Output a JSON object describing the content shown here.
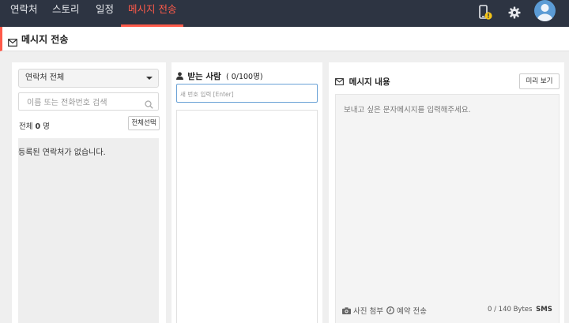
{
  "nav": {
    "items": [
      "연락처",
      "스토리",
      "일정",
      "메시지 전송"
    ],
    "active_index": 3
  },
  "icons": {
    "device": "phone-alert-icon",
    "settings": "gear-icon",
    "profile": "user-avatar-icon"
  },
  "colors": {
    "accent": "#ff5a4a",
    "nav_bg": "#2d3442",
    "alert": "#f5c518",
    "focus": "#6aa2d6"
  },
  "page": {
    "title": "메시지 전송"
  },
  "contacts": {
    "filter": "연락처 전체",
    "search_placeholder": "이름 또는 전화번호 검색",
    "count_prefix": "전체",
    "count_value": "0",
    "count_unit": "명",
    "select_all": "전체선택",
    "empty_text": "등록된 연락처가 없습니다."
  },
  "recipients": {
    "label": "받는 사람",
    "count": "( 0/100명)",
    "input_placeholder": "새 번호 입력 [Enter]"
  },
  "message": {
    "title": "메시지 내용",
    "preview": "미리 보기",
    "placeholder": "보내고 싶은 문자메시지를 입력해주세요.",
    "attach_photo": "사진 첨부",
    "schedule": "예약 전송",
    "bytes": "0 / 140 Bytes",
    "type": "SMS"
  }
}
